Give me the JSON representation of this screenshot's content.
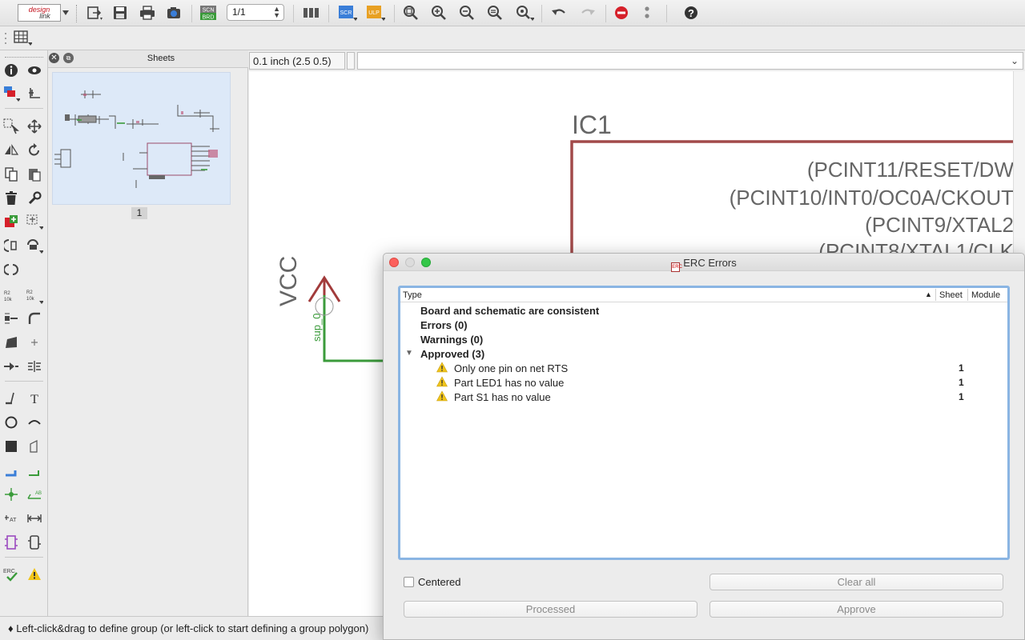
{
  "toolbar": {
    "logo_top": "design",
    "logo_bottom": "link",
    "sheet_selector_value": "1/1",
    "icons": [
      "open-icon",
      "save-icon",
      "print-icon",
      "cam-icon",
      "scn-brd-icon",
      "sheet-selector",
      "ulp-bar-icon",
      "script-icon",
      "ulp-icon",
      "zoom-fit-icon",
      "zoom-in-icon",
      "zoom-out-icon",
      "zoom-redraw-icon",
      "zoom-select-icon",
      "undo-icon",
      "redo-icon",
      "stop-icon",
      "more-icon",
      "help-icon"
    ],
    "scn_label_top": "SCN",
    "scn_label_bottom": "BRD",
    "scr_label": "SCR",
    "ulp_label": "ULP"
  },
  "sheets_panel": {
    "title": "Sheets",
    "page_number": "1"
  },
  "editor": {
    "coordinate": "0.1 inch (2.5 0.5)",
    "command_input": ""
  },
  "schematic": {
    "part_name": "IC1",
    "pin_labels": [
      "(PCINT11/RESET/DW",
      "(PCINT10/INT0/OC0A/CKOUT",
      "(PCINT9/XTAL2",
      "(PCINT8/XTAL1/CLK"
    ],
    "supply_label": "VCC",
    "supply_pin_label": "sup_0",
    "colors": {
      "part_outline": "#a24a4a",
      "net": "#3b9b3b",
      "supply": "#a23b3b"
    }
  },
  "status": {
    "text": "Left-click&drag to define group (or left-click to start defining a group polygon)"
  },
  "erc_dialog": {
    "title": "ERC Errors",
    "title_icon_text": "ERC",
    "columns": {
      "type": "Type",
      "sheet": "Sheet",
      "module": "Module"
    },
    "rows": [
      {
        "label": "Board and schematic are consistent"
      },
      {
        "label": "Errors (0)"
      },
      {
        "label": "Warnings (0)"
      },
      {
        "label": "Approved (3)"
      }
    ],
    "approved_items": [
      {
        "label": "Only one pin on net RTS",
        "sheet": "1"
      },
      {
        "label": "Part LED1 has no value",
        "sheet": "1"
      },
      {
        "label": "Part S1 has no value",
        "sheet": "1"
      }
    ],
    "centered_label": "Centered",
    "clear_all_label": "Clear all",
    "processed_label": "Processed",
    "approve_label": "Approve"
  }
}
